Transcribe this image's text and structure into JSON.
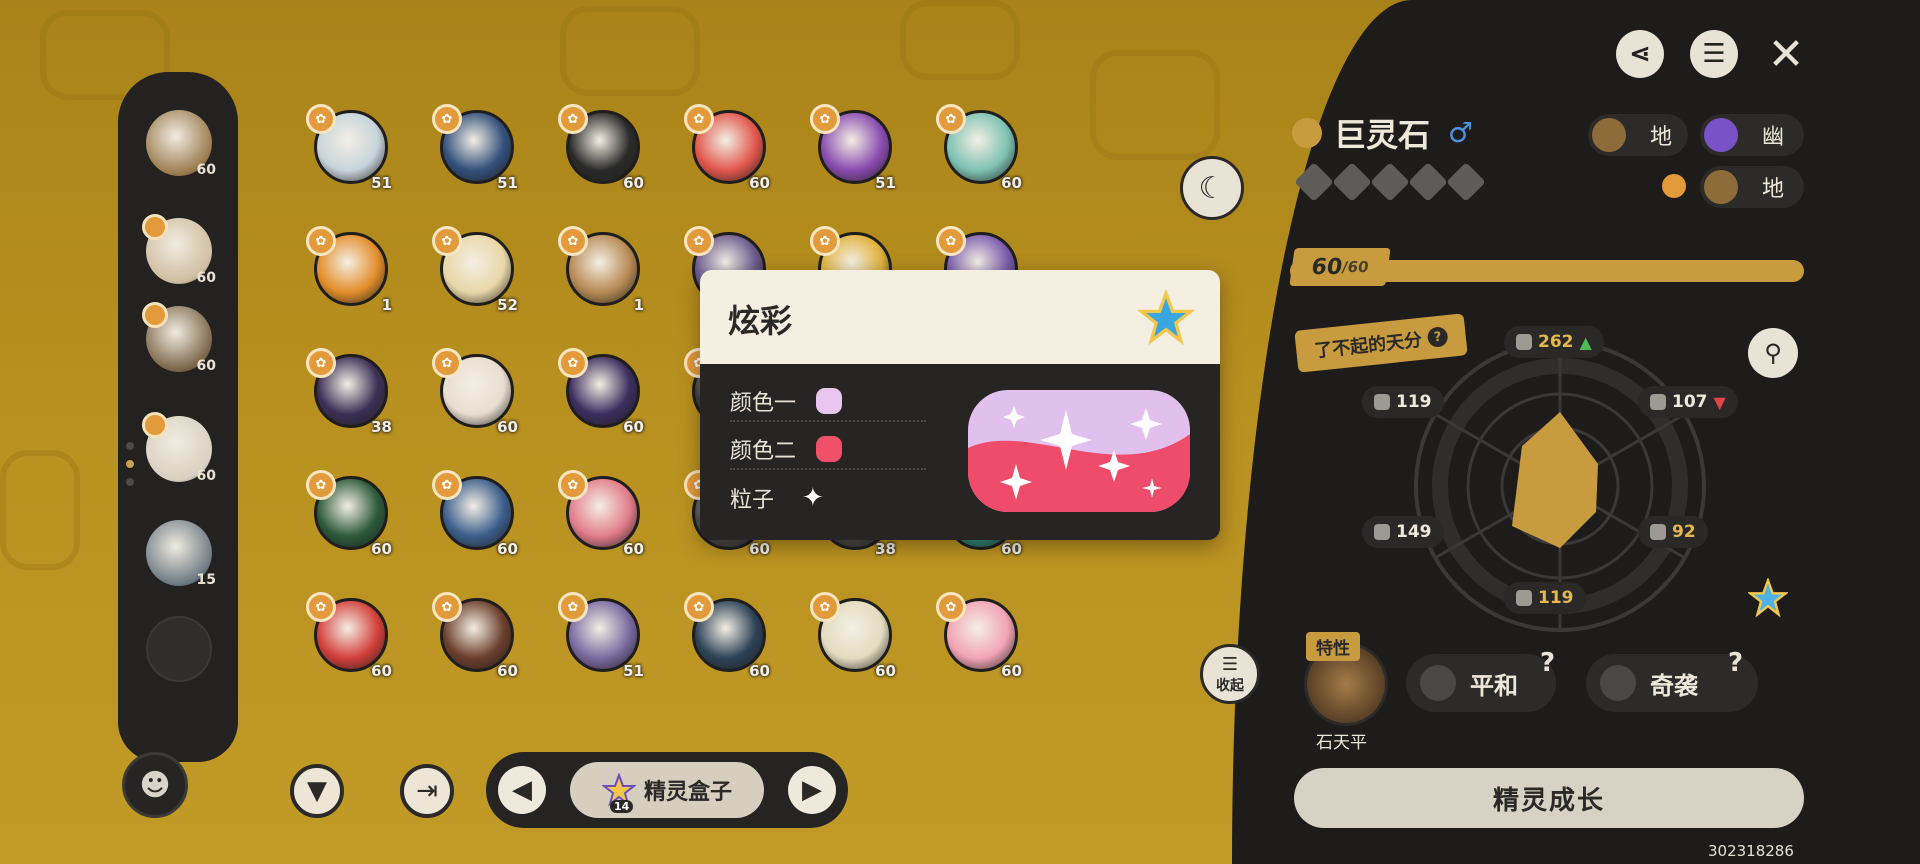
{
  "sidebar": {
    "items": [
      {
        "level": "60",
        "color": "#9a7a4c"
      },
      {
        "level": "60",
        "color": "#cfbda0"
      },
      {
        "level": "60",
        "color": "#7a6548"
      },
      {
        "level": "60",
        "color": "#d8d0c0"
      },
      {
        "level": "15",
        "color": "#6c7a82"
      }
    ]
  },
  "grid": {
    "cells": [
      {
        "level": "51",
        "color": "#c7d4db"
      },
      {
        "level": "51",
        "color": "#33507c"
      },
      {
        "level": "60",
        "color": "#2a2a2a"
      },
      {
        "level": "60",
        "color": "#e1574c"
      },
      {
        "level": "51",
        "color": "#8a4cb0"
      },
      {
        "level": "60",
        "color": "#7ec2b3"
      },
      {
        "level": "1",
        "color": "#e38d2a"
      },
      {
        "level": "52",
        "color": "#e9d7a8"
      },
      {
        "level": "1",
        "color": "#b78a54"
      },
      {
        "level": "",
        "color": "#6a5a8c"
      },
      {
        "level": "",
        "color": "#e0b23b"
      },
      {
        "level": "",
        "color": "#7b5cae"
      },
      {
        "level": "38",
        "color": "#3c2f56"
      },
      {
        "level": "60",
        "color": "#e8ddd0"
      },
      {
        "level": "60",
        "color": "#3b2d5e"
      },
      {
        "level": "",
        "color": "#444"
      },
      {
        "level": "",
        "color": "#444"
      },
      {
        "level": "",
        "color": "#444"
      },
      {
        "level": "60",
        "color": "#2c5a3a"
      },
      {
        "level": "60",
        "color": "#3b5e8c"
      },
      {
        "level": "60",
        "color": "#e27c8a"
      },
      {
        "level": "60",
        "color": "#555"
      },
      {
        "level": "38",
        "color": "#555"
      },
      {
        "level": "60",
        "color": "#36a38f"
      },
      {
        "level": "60",
        "color": "#d33f3a"
      },
      {
        "level": "60",
        "color": "#6b3e2c"
      },
      {
        "level": "51",
        "color": "#7b6aa0"
      },
      {
        "level": "60",
        "color": "#2c4257"
      },
      {
        "level": "60",
        "color": "#e3dcc0"
      },
      {
        "level": "60",
        "color": "#f2a3b5"
      }
    ]
  },
  "bottom_bar": {
    "filter_icon": "filter-icon",
    "exit_icon": "exit-icon",
    "box_label": "精灵盒子",
    "box_count": "14"
  },
  "popup": {
    "title": "炫彩",
    "rows": [
      {
        "label": "颜色一",
        "swatch": "#e8c6f0"
      },
      {
        "label": "颜色二",
        "swatch": "#f0506a"
      },
      {
        "label": "粒子",
        "glyph": "✦"
      }
    ],
    "sample_top": "#e2c0ee",
    "sample_bottom": "#ef4b6a"
  },
  "pet": {
    "name": "巨灵石",
    "gender": "♂",
    "types": [
      {
        "label": "地",
        "color": "#8d6c3a"
      },
      {
        "label": "幽",
        "color": "#7a52c8"
      }
    ],
    "sub_type": {
      "label": "地",
      "color": "#8d6c3a"
    },
    "level": "60",
    "level_max": "/60",
    "talent": "了不起的天分",
    "stats": {
      "hp": "262",
      "atk": "107",
      "def": "92",
      "spd": "119",
      "sdef": "149",
      "satk": "119"
    },
    "trait_tag": "特性",
    "trait_name": "石天平",
    "nature1": "平和",
    "nature2": "奇袭",
    "grow_label": "精灵成长",
    "collapse_label": "收起"
  },
  "footer": {
    "uid": "302318286"
  },
  "colors": {
    "accent": "#c99b3f",
    "panel": "#1d1c1b",
    "background": "#b8901f"
  }
}
